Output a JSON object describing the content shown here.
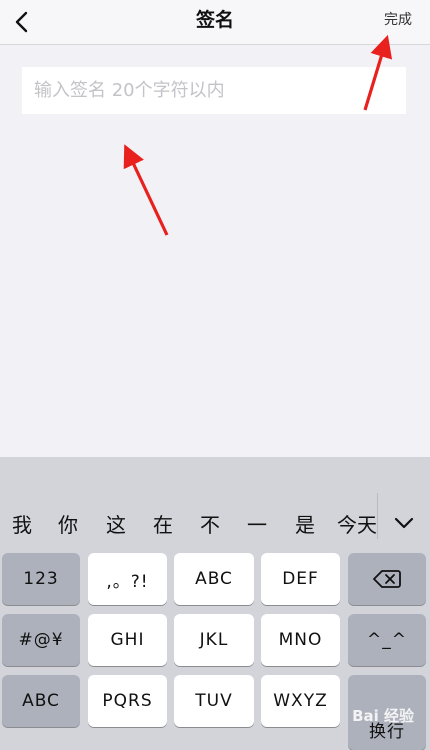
{
  "nav": {
    "title": "签名",
    "done_label": "完成"
  },
  "signature": {
    "placeholder": "输入签名 20个字符以内",
    "value": ""
  },
  "keyboard": {
    "candidates": [
      "我",
      "你",
      "这",
      "在",
      "不",
      "一",
      "是",
      "今天"
    ],
    "keys": {
      "num": "123",
      "punct": ",。?!",
      "abc": "ABC",
      "def": "DEF",
      "symbols": "#@¥",
      "ghi": "GHI",
      "jkl": "JKL",
      "mno": "MNO",
      "emoticon": "^_^",
      "abc_mode": "ABC",
      "pqrs": "PQRS",
      "tuv": "TUV",
      "wxyz": "WXYZ",
      "return": "换行"
    }
  },
  "watermark": "Bai 经验",
  "colors": {
    "arrow": "#e8201e",
    "background": "#f2f1f6",
    "keyboard": "#d2d4da"
  },
  "icons": [
    "chevron-left-icon",
    "chevron-down-icon",
    "delete-backspace-icon"
  ]
}
